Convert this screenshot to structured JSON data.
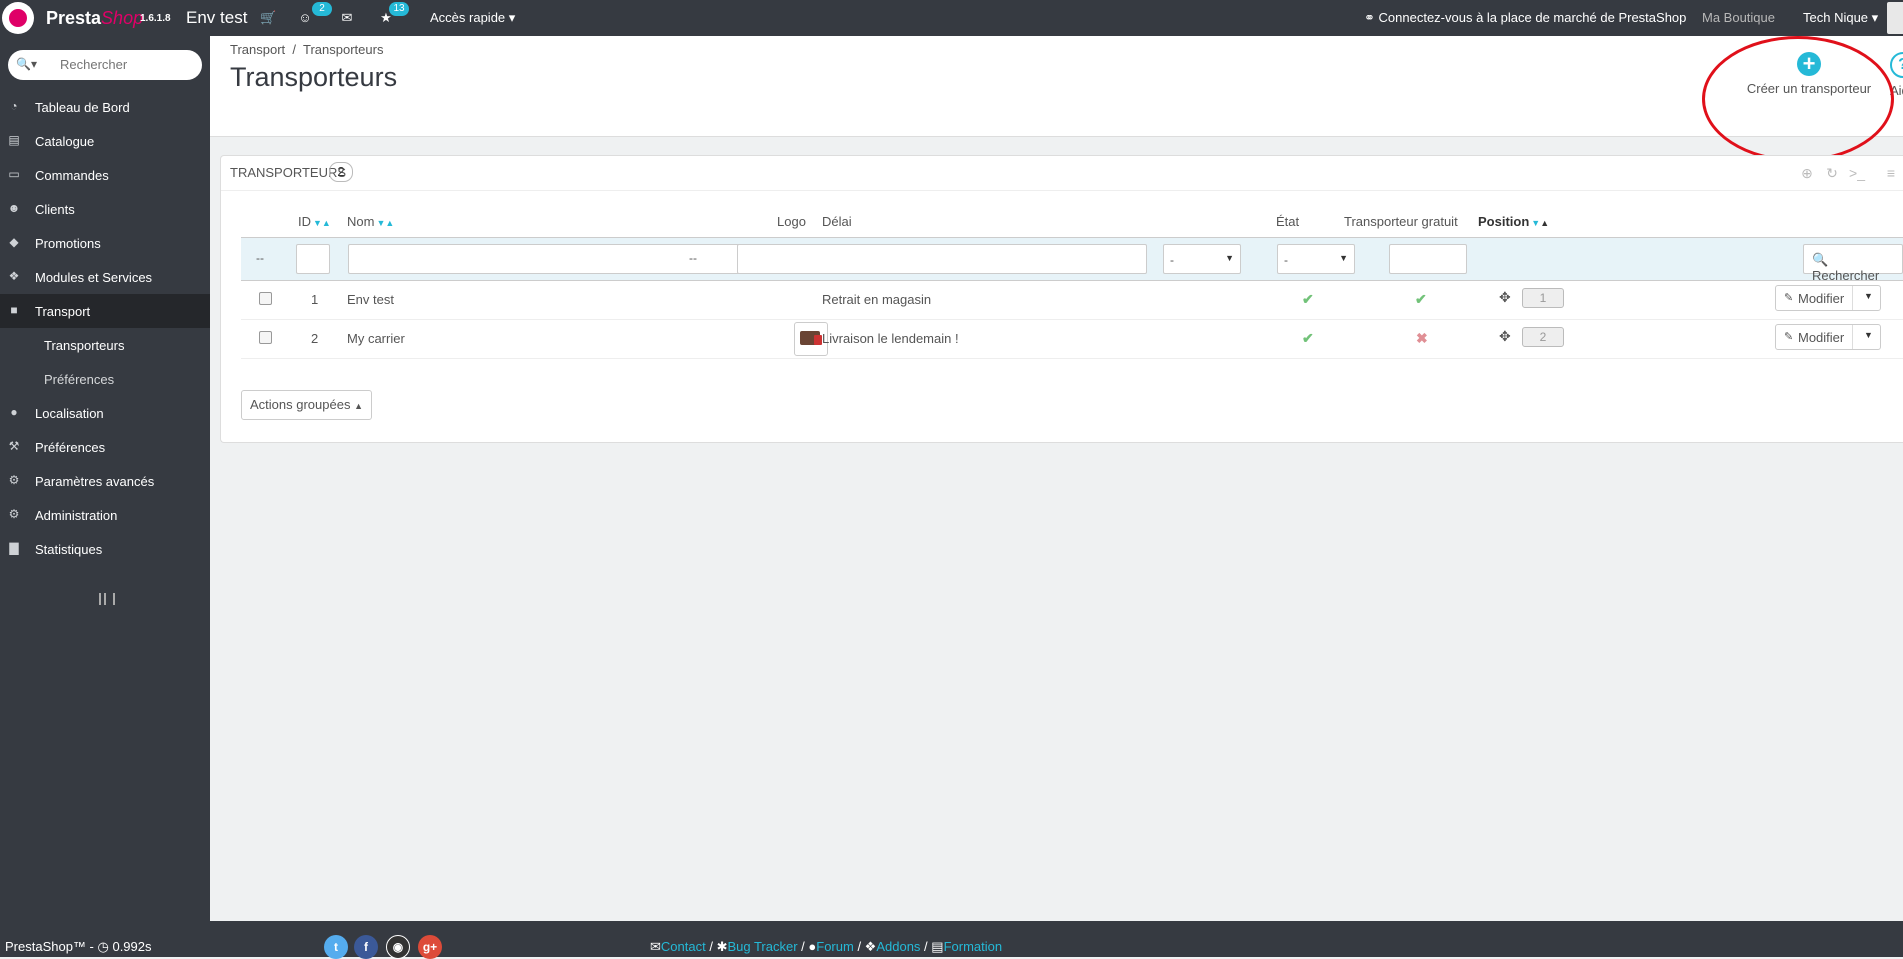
{
  "topbar": {
    "brand_presta": "Presta",
    "brand_shop": "Shop",
    "version": "1.6.1.8",
    "shop_name": "Env test",
    "customers_badge": "2",
    "trophy_badge": "13",
    "quick_access": "Accès rapide",
    "marketplace": "Connectez-vous à la place de marché de PrestaShop",
    "my_shop": "Ma Boutique",
    "user_name": "Tech Nique"
  },
  "sidebar": {
    "search_placeholder": "Rechercher",
    "items": [
      {
        "label": "Tableau de Bord",
        "icon": "dashboard-icon"
      },
      {
        "label": "Catalogue",
        "icon": "book-icon"
      },
      {
        "label": "Commandes",
        "icon": "credit-card-icon"
      },
      {
        "label": "Clients",
        "icon": "users-icon"
      },
      {
        "label": "Promotions",
        "icon": "tag-icon"
      },
      {
        "label": "Modules et Services",
        "icon": "puzzle-icon"
      },
      {
        "label": "Transport",
        "icon": "truck-icon"
      },
      {
        "label": "Localisation",
        "icon": "globe-icon"
      },
      {
        "label": "Préférences",
        "icon": "wrench-icon"
      },
      {
        "label": "Paramètres avancés",
        "icon": "cogs-icon"
      },
      {
        "label": "Administration",
        "icon": "cog-icon"
      },
      {
        "label": "Statistiques",
        "icon": "bar-chart-icon"
      }
    ],
    "subitems": [
      "Transporteurs",
      "Préférences"
    ]
  },
  "header": {
    "breadcrumb_1": "Transport",
    "breadcrumb_sep": "/",
    "breadcrumb_2": "Transporteurs",
    "title": "Transporteurs",
    "create_label": "Créer un transporteur",
    "help_label": "Aide"
  },
  "panel": {
    "title": "Transporteurs",
    "count": "2",
    "columns": {
      "id": "ID",
      "name": "Nom",
      "logo": "Logo",
      "delay": "Délai",
      "status": "État",
      "free": "Transporteur gratuit",
      "position": "Position"
    },
    "filter_dash": "--",
    "filter_select_value": "-",
    "search_button": "Rechercher",
    "rows": [
      {
        "id": "1",
        "name": "Env test",
        "delay": "Retrait en magasin",
        "active": true,
        "free": true,
        "position": "1"
      },
      {
        "id": "2",
        "name": "My carrier",
        "delay": "Livraison le lendemain !",
        "active": true,
        "free": false,
        "position": "2"
      }
    ],
    "edit_label": "Modifier",
    "bulk_actions": "Actions groupées"
  },
  "footer": {
    "brand": "PrestaShop™ - ",
    "timer": "0.992s",
    "links": [
      "Contact",
      "Bug Tracker",
      "Forum",
      "Addons",
      "Formation"
    ],
    "sep": " / "
  },
  "colors": {
    "topbar": "#363a41",
    "accent": "#25b9d7",
    "brand_pink": "#df0067",
    "highlight_circle": "#e0101a"
  }
}
